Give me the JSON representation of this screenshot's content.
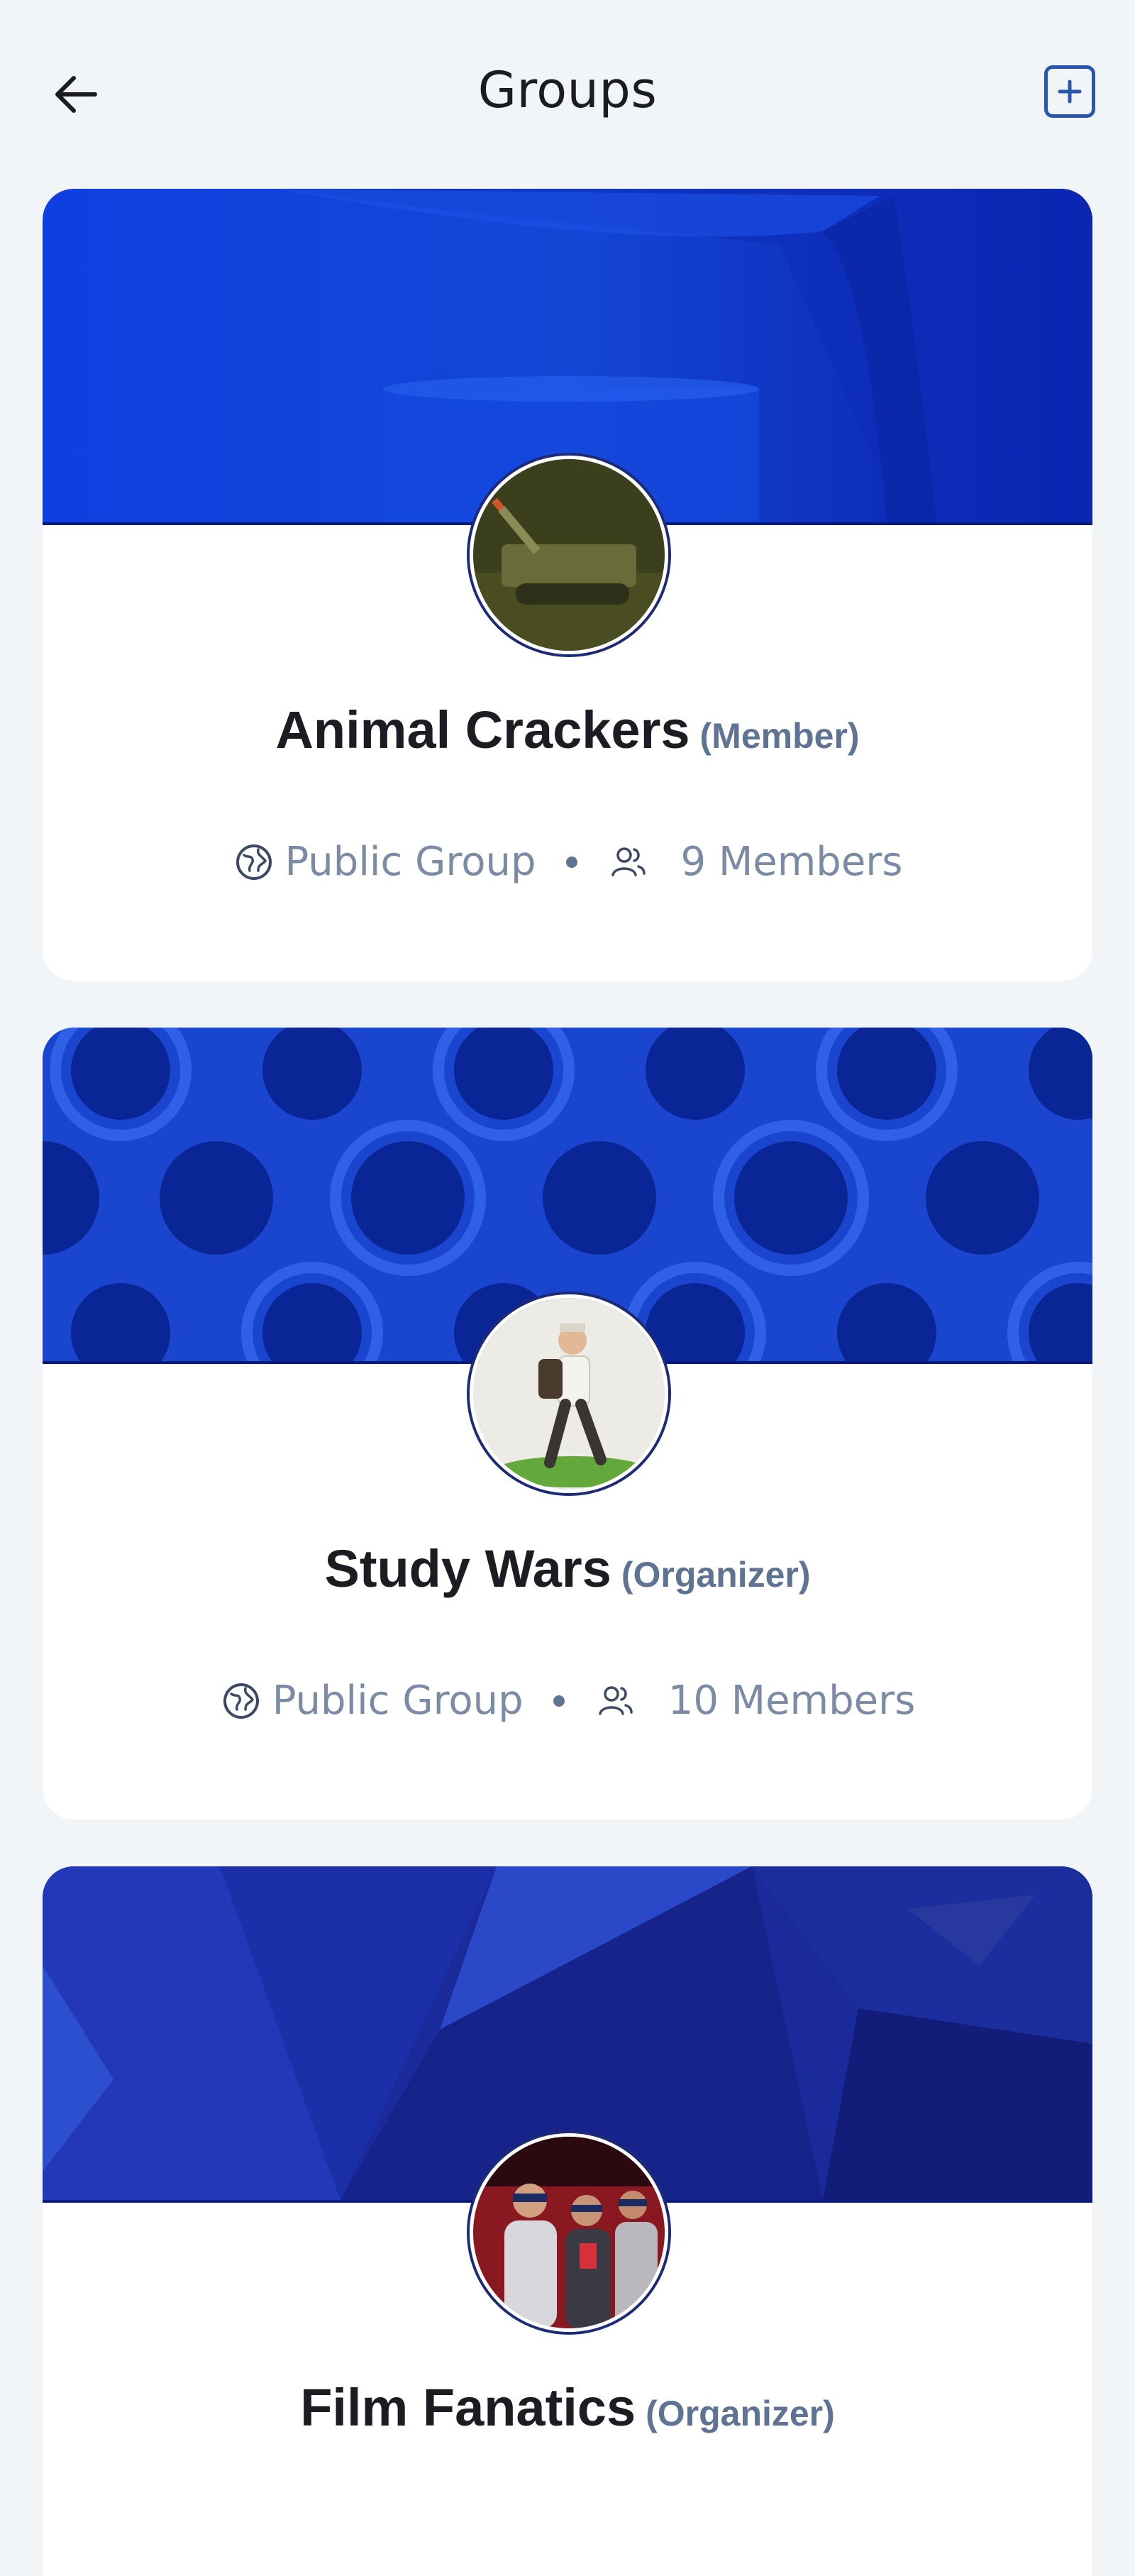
{
  "header": {
    "title": "Groups",
    "back_icon": "arrow-left-icon",
    "add_icon": "plus-square-icon"
  },
  "groups": [
    {
      "name": "Animal Crackers",
      "role": "(Member)",
      "visibility": "Public Group",
      "members": "9 Members",
      "banner": "blue-curved-podium",
      "avatar": "tank-photo"
    },
    {
      "name": "Study Wars",
      "role": "(Organizer)",
      "visibility": "Public Group",
      "members": "10 Members",
      "banner": "blue-lattice-pattern",
      "avatar": "walking-traveler-photo"
    },
    {
      "name": "Film Fanatics",
      "role": "(Organizer)",
      "banner": "dark-blue-polygons",
      "avatar": "cinema-audience-photo"
    }
  ],
  "colors": {
    "background": "#f2f5f7",
    "accent": "#2b56b0",
    "muted_text": "#7b8ba6",
    "role_text": "#5f7393"
  }
}
